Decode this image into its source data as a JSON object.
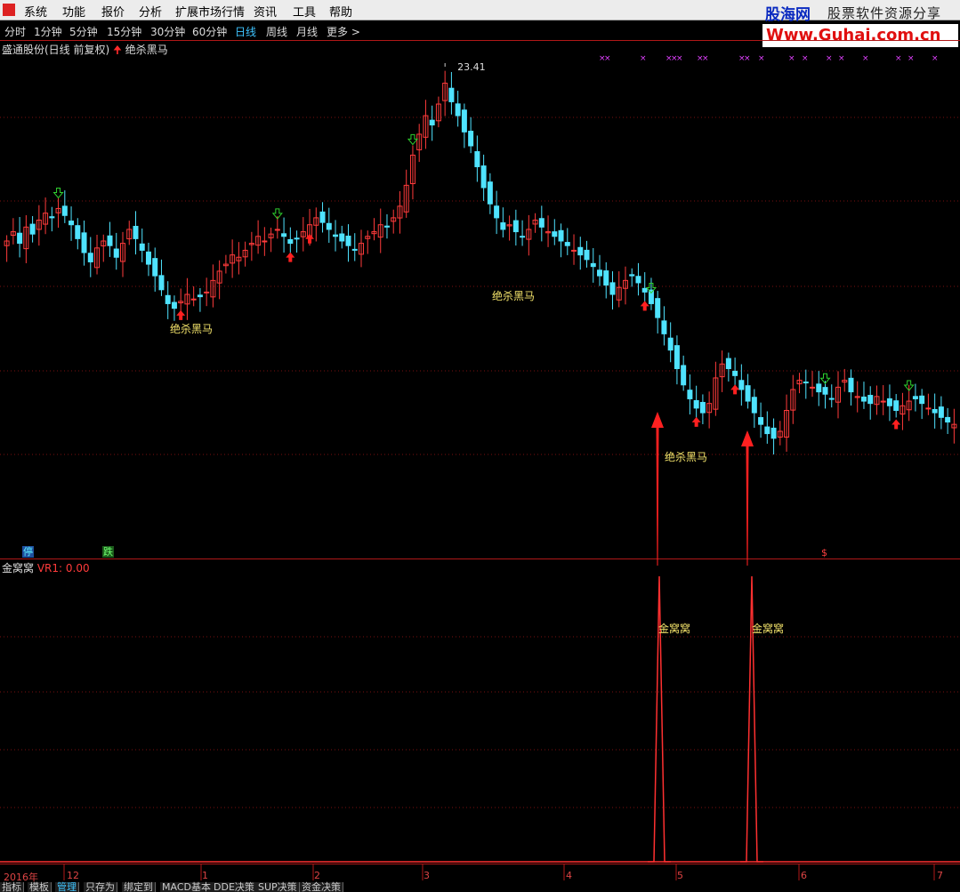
{
  "menu": [
    "系统",
    "功能",
    "报价",
    "分析",
    "扩展市场行情",
    "资讯",
    "工具",
    "帮助"
  ],
  "brand": {
    "name": "股海网",
    "slogan": "股票软件资源分享",
    "url": "Www.Guhai.com.cn"
  },
  "periods": [
    "分时",
    "1分钟",
    "5分钟",
    "15分钟",
    "30分钟",
    "60分钟",
    "日线",
    "周线",
    "月线",
    "更多 >"
  ],
  "active_period": "日线",
  "main_panel": {
    "stock": "盛通股份(日线 前复权)",
    "indicator": "绝杀黑马",
    "peak_price": "23.41",
    "signal_labels": [
      "绝杀黑马",
      "绝杀黑马",
      "绝杀黑马"
    ],
    "badges": [
      "停",
      "跌",
      "$"
    ]
  },
  "sub_panel": {
    "indicator": "金窝窝",
    "value_text": "VR1: 0.00",
    "peak_labels": [
      "金窝窝",
      "金窝窝"
    ]
  },
  "time_axis": [
    "2016年",
    "12",
    "1",
    "2",
    "3",
    "4",
    "5",
    "6",
    "7"
  ],
  "bottom_tabs": [
    "指标",
    "模板",
    "管理",
    "只存为",
    "绑定到",
    "MACD基本",
    "DDE决策",
    "SUP决策",
    "资金决策"
  ],
  "active_tab": "管理",
  "colors": {
    "up_candle": "#ff3b3b",
    "down_candle": "#4fe3ff",
    "grid": "#7a1010",
    "signal_text": "#f2e26a",
    "buy_arrow": "#ff2020",
    "sell_arrow": "#2fd02f",
    "cross_marks": "#e040ff"
  },
  "chart_data": {
    "type": "candlestick",
    "price_max": 23.41,
    "closes": [
      15.9,
      16.3,
      15.8,
      16.5,
      16.2,
      16.8,
      17.1,
      16.9,
      17.3,
      17.0,
      16.6,
      16.0,
      15.4,
      15.0,
      15.6,
      15.9,
      15.7,
      15.2,
      15.8,
      16.4,
      16.0,
      15.5,
      14.9,
      14.4,
      13.8,
      13.2,
      13.0,
      13.3,
      13.6,
      13.4,
      13.5,
      13.7,
      14.2,
      14.6,
      14.9,
      15.3,
      15.2,
      15.5,
      15.8,
      16.1,
      15.9,
      16.2,
      16.4,
      16.1,
      15.8,
      16.0,
      16.3,
      16.6,
      16.9,
      16.7,
      16.4,
      16.1,
      15.9,
      15.7,
      15.5,
      15.8,
      16.1,
      16.3,
      16.6,
      16.5,
      16.9,
      17.4,
      18.3,
      19.6,
      20.5,
      21.3,
      20.9,
      21.8,
      22.7,
      21.9,
      21.3,
      20.6,
      20.0,
      19.1,
      18.2,
      17.5,
      16.9,
      16.4,
      16.6,
      16.3,
      16.1,
      16.4,
      16.8,
      16.5,
      16.3,
      16.1,
      15.9,
      15.7,
      15.5,
      15.3,
      15.1,
      14.8,
      14.4,
      14.0,
      13.6,
      13.9,
      14.2,
      14.4,
      14.1,
      13.7,
      13.2,
      12.6,
      11.9,
      11.2,
      10.4,
      9.7,
      9.1,
      8.7,
      8.5,
      8.9,
      10.0,
      10.6,
      10.4,
      10.1,
      9.5,
      9.0,
      8.5,
      8.0,
      7.6,
      7.4,
      7.7,
      8.6,
      9.5,
      9.9,
      9.8,
      9.6,
      9.4,
      9.3,
      9.1,
      9.6,
      9.9,
      9.4,
      9.2,
      9.0,
      8.9,
      9.2,
      9.0,
      8.8,
      8.6,
      8.8,
      9.0,
      9.1,
      8.9,
      8.7,
      8.5,
      8.3,
      8.1,
      8.0
    ]
  }
}
